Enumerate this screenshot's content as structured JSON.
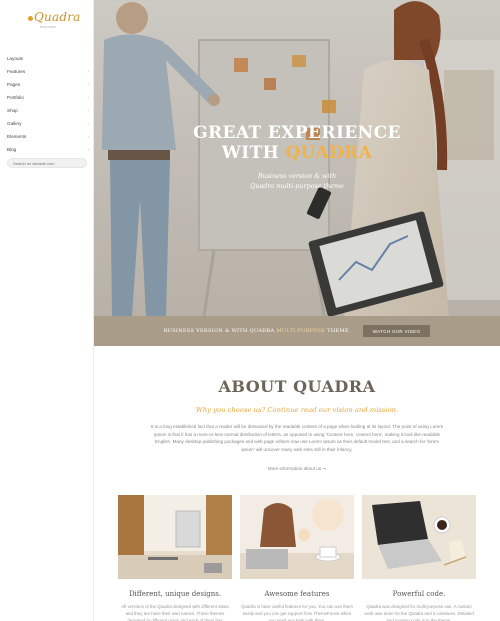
{
  "brand": {
    "name": "Quadra",
    "tagline": "business"
  },
  "nav": {
    "items": [
      {
        "label": "Layouts"
      },
      {
        "label": "Features"
      },
      {
        "label": "Pages"
      },
      {
        "label": "Portfolio"
      },
      {
        "label": "Shop"
      },
      {
        "label": "Gallery"
      },
      {
        "label": "Elements"
      },
      {
        "label": "Blog"
      }
    ],
    "chevron": "›"
  },
  "search": {
    "placeholder": "Search on website.com"
  },
  "hero": {
    "title_line1": "GREAT EXPERIENCE",
    "title_line2_prefix": "WITH ",
    "title_line2_accent": "QUADRA",
    "subtitle_line1": "Business version & with",
    "subtitle_line2": "Quadra multi-purpose theme"
  },
  "banner": {
    "text_prefix": "BUSINESS VERSION & WITH QUADRA ",
    "text_accent": "MULTI-PURPOSE",
    "text_suffix": " THEME",
    "button_label": "WATCH OUR VIDEO"
  },
  "about": {
    "title": "ABOUT QUADRA",
    "tagline": "Why you choose us? Continue read our vision and mission.",
    "body": "It is a long established fact that a reader will be distracted by the readable content of a page when looking at its layout. The point of using Lorem Ipsum is that it has a more-or-less normal distribution of letters, as opposed to using 'Content here, content here', making it look like readable English. Many desktop publishing packages and web page editors now use Lorem Ipsum as their default model text, and a search for 'lorem ipsum' will uncover many web sites still in their infancy.",
    "link_label": "More information about us ➞"
  },
  "cards": [
    {
      "title": "Different, unique designs.",
      "text": "All versions of the Quadra designed with different ideas and they are have their own names. These themes designed to different users and each of them has"
    },
    {
      "title": "Awesome features",
      "text": "Quadra is have useful features for you. You can use them easily and you can get support from ThemeForest when you need any help with them."
    },
    {
      "title": "Powerful code.",
      "text": "Quadra was designed for multi-purpose use. A custom work was done for the Quadra and it continues. Detailed and modern code is in the theme."
    }
  ],
  "colors": {
    "accent": "#e5a637",
    "banner": "#a99d8a",
    "banner_button": "#7d7262"
  }
}
